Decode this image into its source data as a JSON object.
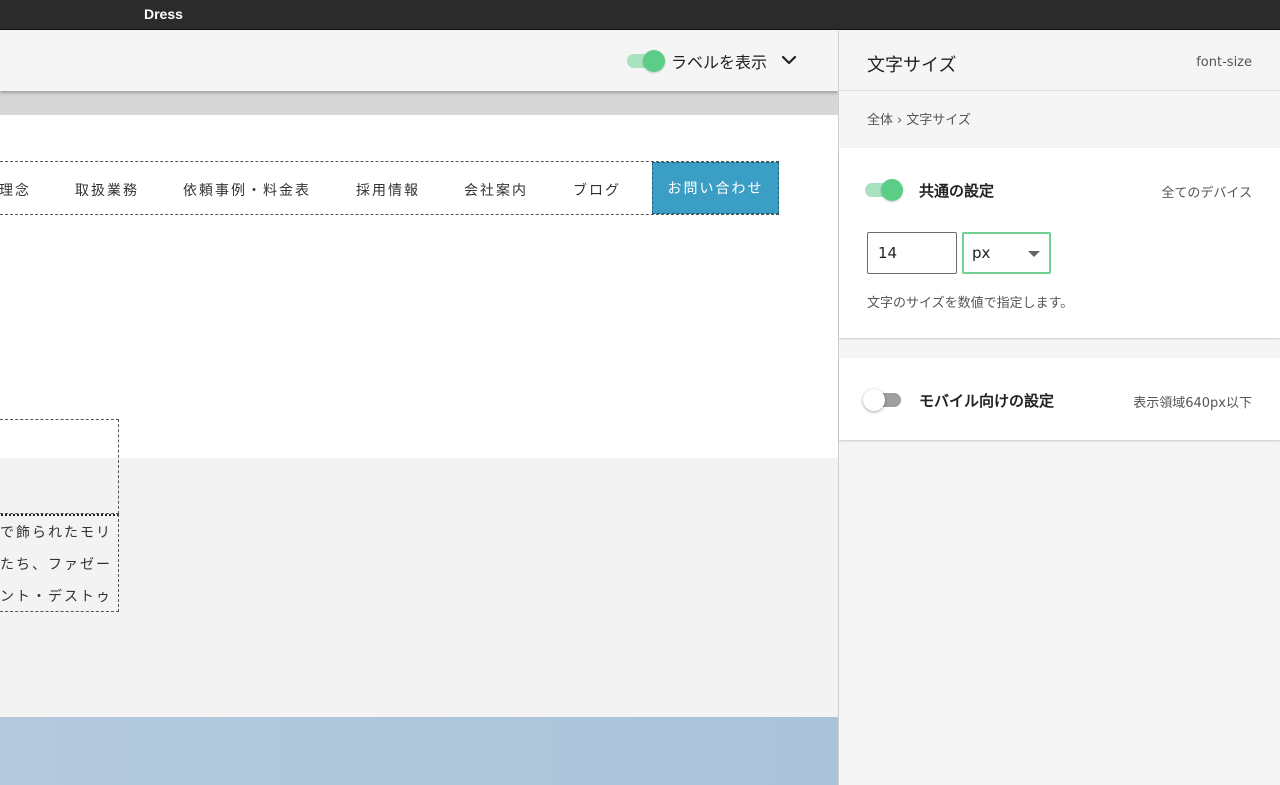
{
  "app": {
    "title": "Dress"
  },
  "preview": {
    "toolbar": {
      "label_toggle": "ラベルを表示",
      "label_toggle_on": true
    },
    "nav": {
      "items": [
        "理念",
        "取扱業務",
        "依頼事例・料金表",
        "採用情報",
        "会社案内",
        "ブログ"
      ],
      "contact": "お問い合わせ",
      "contact_color": "#3b9ec4"
    },
    "body_text": [
      "で飾られたモリ",
      "たち、ファゼー",
      "ント・デストゥ"
    ]
  },
  "panel": {
    "title": "文字サイズ",
    "property": "font-size",
    "breadcrumb": {
      "root": "全体",
      "current": "文字サイズ"
    },
    "common": {
      "label": "共通の設定",
      "scope": "全てのデバイス",
      "enabled": true,
      "value": "14",
      "unit": "px",
      "help": "文字のサイズを数値で指定します。"
    },
    "mobile": {
      "label": "モバイル向けの設定",
      "scope": "表示領域640px以下",
      "enabled": false
    },
    "accent_color": "#5ccd86"
  }
}
